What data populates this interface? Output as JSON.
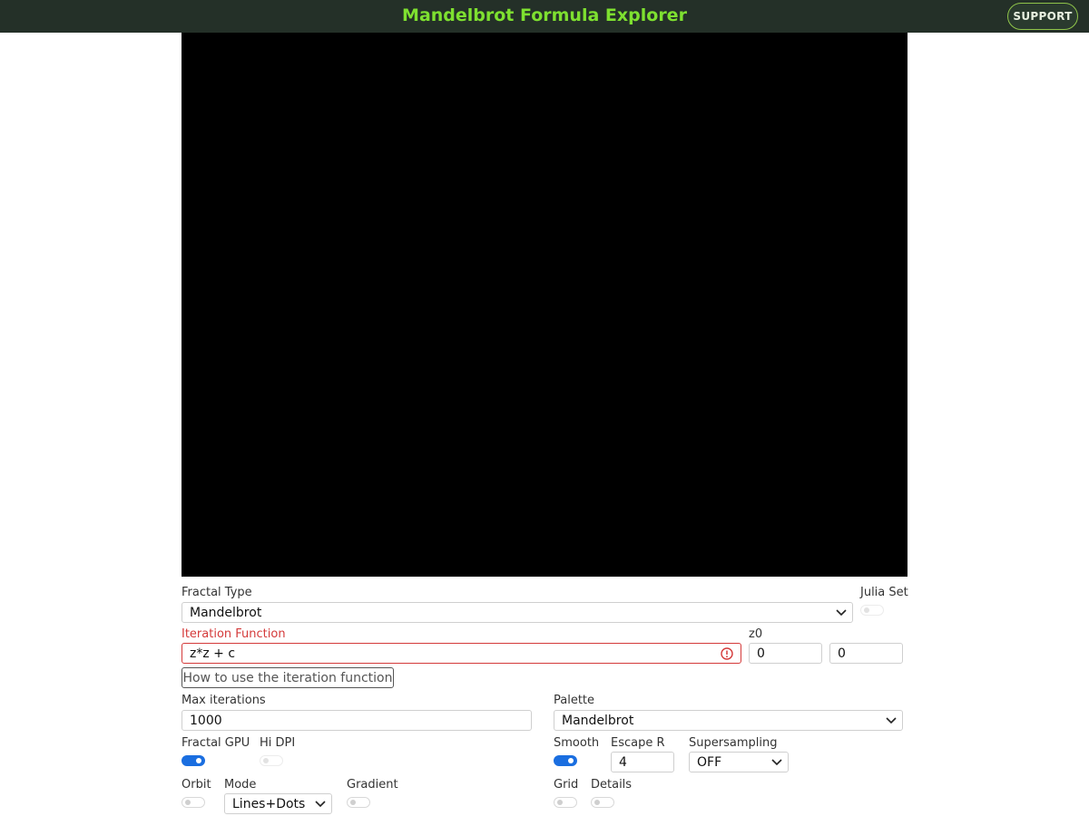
{
  "header": {
    "title": "Mandelbrot Formula Explorer",
    "support_label": "SUPPORT",
    "title_color": "#7ee030",
    "background": "#243028"
  },
  "controls": {
    "fractal_type": {
      "label": "Fractal Type",
      "value": "Mandelbrot"
    },
    "julia_set": {
      "label": "Julia Set",
      "checked": false,
      "disabled": true
    },
    "iteration_function": {
      "label": "Iteration Function",
      "value": "z*z + c",
      "state": "error"
    },
    "z0": {
      "label": "z0",
      "real": "0",
      "imag": "0"
    },
    "help_button_label": "How to use the iteration function",
    "max_iterations": {
      "label": "Max iterations",
      "value": "1000"
    },
    "palette": {
      "label": "Palette",
      "value": "Mandelbrot"
    },
    "fractal_gpu": {
      "label": "Fractal GPU",
      "checked": true
    },
    "hi_dpi": {
      "label": "Hi DPI",
      "checked": false,
      "disabled": true
    },
    "smooth": {
      "label": "Smooth",
      "checked": true
    },
    "escape_r": {
      "label": "Escape R",
      "value": "4"
    },
    "supersampling": {
      "label": "Supersampling",
      "value": "OFF"
    },
    "orbit": {
      "label": "Orbit",
      "checked": false
    },
    "mode": {
      "label": "Mode",
      "value": "Lines+Dots"
    },
    "gradient": {
      "label": "Gradient",
      "checked": false
    },
    "grid": {
      "label": "Grid",
      "checked": false
    },
    "details": {
      "label": "Details",
      "checked": false
    }
  },
  "colors": {
    "accent": "#1a6ee0",
    "error": "#d43a3a",
    "canvas": "#000000"
  },
  "icons": {
    "dropdown": "chevron-down-icon",
    "error": "error-circle-icon"
  }
}
